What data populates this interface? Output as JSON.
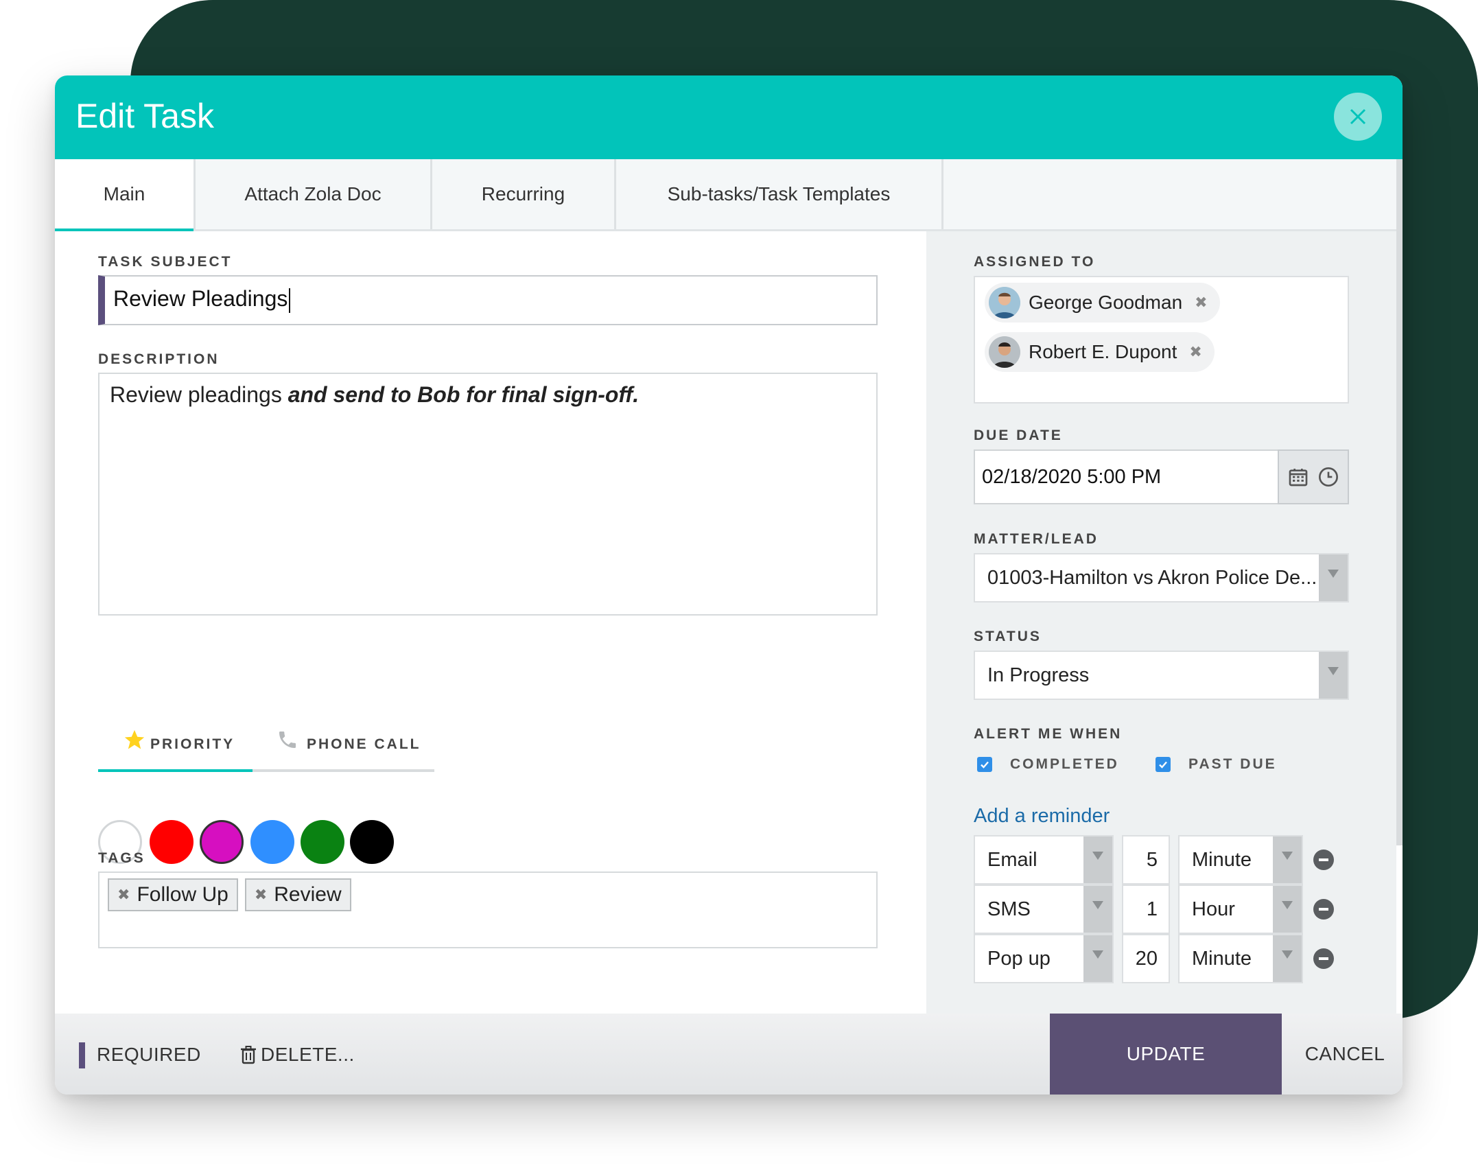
{
  "dialog": {
    "title": "Edit Task",
    "tabs": [
      "Main",
      "Attach Zola Doc",
      "Recurring",
      "Sub-tasks/Task Templates"
    ]
  },
  "main": {
    "subject_label": "TASK SUBJECT",
    "subject_value": "Review Pleadings",
    "description_label": "DESCRIPTION",
    "description_plain": "Review pleadings ",
    "description_bold_italic": "and send to Bob for final sign-off.",
    "priority_tabs": {
      "priority": "PRIORITY",
      "phone_call": "PHONE CALL"
    },
    "colors": [
      "#ffffff",
      "#ff0000",
      "#d60fc0",
      "#2f8fff",
      "#0a8212",
      "#000000"
    ],
    "tags_label": "TAGS",
    "tags": [
      "Follow Up",
      "Review"
    ]
  },
  "side": {
    "assigned_label": "ASSIGNED TO",
    "assignees": [
      "George Goodman",
      "Robert E. Dupont"
    ],
    "due_label": "DUE DATE",
    "due_value": "02/18/2020 5:00 PM",
    "matter_label": "MATTER/LEAD",
    "matter_value": "01003-Hamilton vs Akron Police De...",
    "status_label": "STATUS",
    "status_value": "In Progress",
    "alert_label": "ALERT ME WHEN",
    "alert_completed": "COMPLETED",
    "alert_past_due": "PAST DUE",
    "add_reminder": "Add a reminder",
    "reminders": [
      {
        "method": "Email",
        "amount": "5",
        "unit": "Minute"
      },
      {
        "method": "SMS",
        "amount": "1",
        "unit": "Hour"
      },
      {
        "method": "Pop up",
        "amount": "20",
        "unit": "Minute"
      }
    ]
  },
  "footer": {
    "required": "REQUIRED",
    "delete": "DELETE...",
    "update": "UPDATE",
    "cancel": "CANCEL"
  },
  "colors": {
    "header": "#02c4ba",
    "accent_purple": "#5b4f7d",
    "background_dark": "#173b31"
  }
}
